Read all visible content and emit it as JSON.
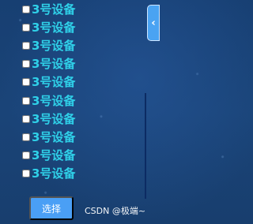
{
  "device_list": {
    "items": [
      {
        "label": "3号设备",
        "checked": false
      },
      {
        "label": "3号设备",
        "checked": false
      },
      {
        "label": "3号设备",
        "checked": false
      },
      {
        "label": "3号设备",
        "checked": false
      },
      {
        "label": "3号设备",
        "checked": false
      },
      {
        "label": "3号设备",
        "checked": false
      },
      {
        "label": "3号设备",
        "checked": false
      },
      {
        "label": "3号设备",
        "checked": false
      },
      {
        "label": "3号设备",
        "checked": false
      },
      {
        "label": "3号设备",
        "checked": false
      }
    ]
  },
  "collapse_tab": {
    "icon": "chevron-left-icon",
    "glyph": "‹"
  },
  "select_button": {
    "label": "选择"
  },
  "watermark": {
    "text": "CSDN @极端~"
  },
  "colors": {
    "label_text": "#2fd0e8",
    "button_bg": "#4a9ff5",
    "background": "#1a4478"
  }
}
